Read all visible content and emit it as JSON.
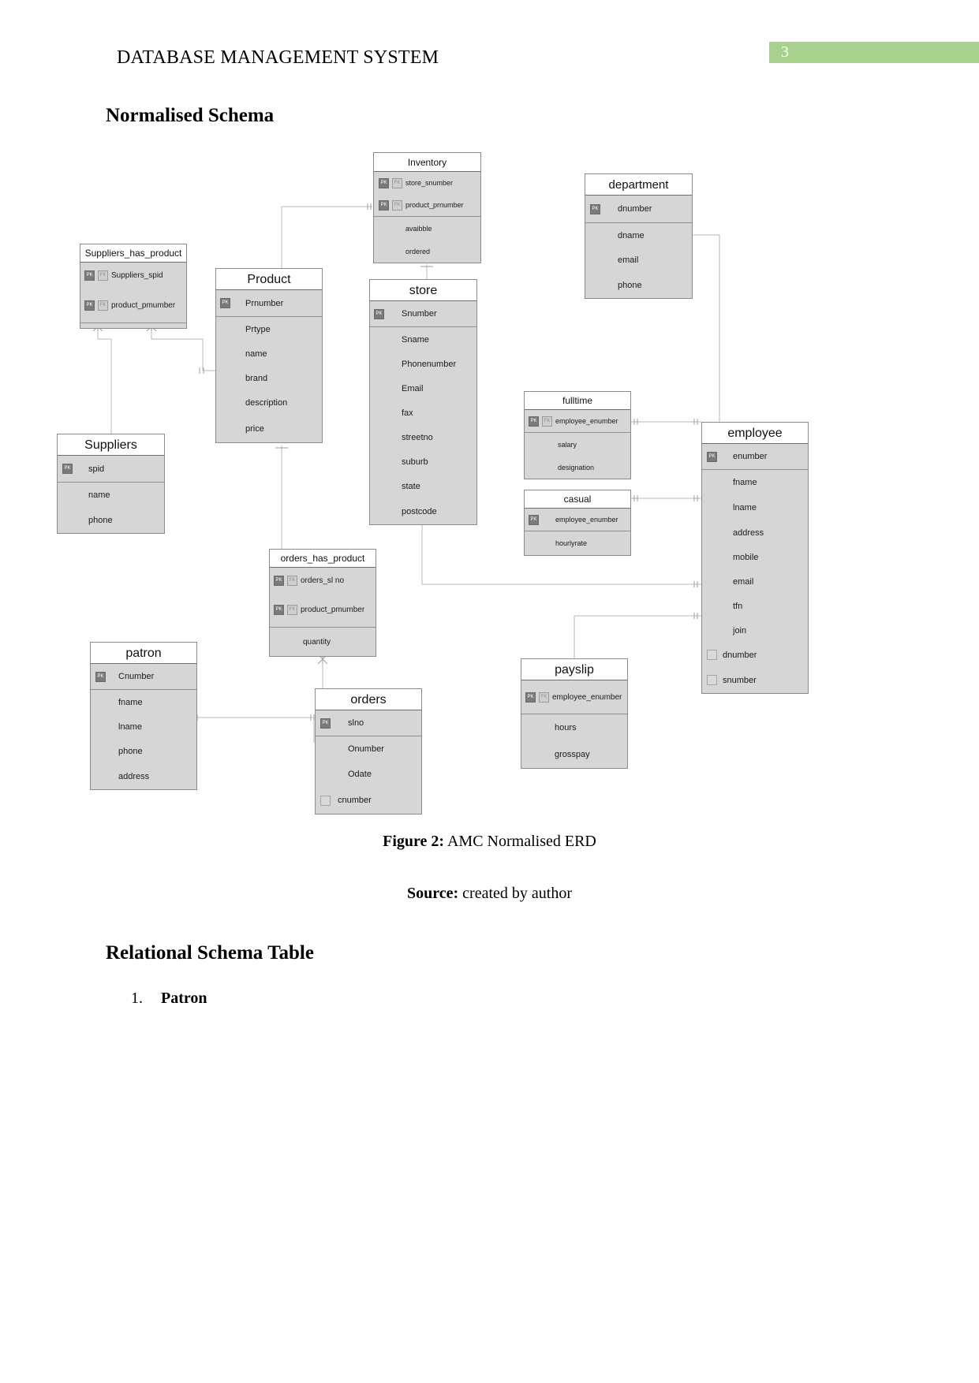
{
  "header": {
    "doc_title": "DATABASE MANAGEMENT SYSTEM",
    "page_number": "3",
    "badge_color": "#a9d18e"
  },
  "headings": {
    "normalised_schema": "Normalised Schema",
    "relational_schema": "Relational Schema Table"
  },
  "captions": {
    "figure_label": "Figure 2:",
    "figure_text": " AMC Normalised ERD",
    "source_label": "Source:",
    "source_text": " created by author"
  },
  "list": {
    "item1_number": "1.",
    "item1_label": "Patron"
  },
  "erd": {
    "entities": [
      {
        "id": "inventory",
        "title": "Inventory",
        "fields": [
          {
            "label": "store_snumber",
            "pk": true,
            "fk": true
          },
          {
            "label": "product_prnumber",
            "pk": true,
            "fk": true
          },
          {
            "label": "avaibble",
            "pk": false,
            "fk": false
          },
          {
            "label": "ordered",
            "pk": false,
            "fk": false
          }
        ]
      },
      {
        "id": "department",
        "title": "department",
        "fields": [
          {
            "label": "dnumber",
            "pk": true,
            "fk": false
          },
          {
            "label": "dname",
            "pk": false,
            "fk": false
          },
          {
            "label": "email",
            "pk": false,
            "fk": false
          },
          {
            "label": "phone",
            "pk": false,
            "fk": false
          }
        ]
      },
      {
        "id": "suppliers_has_product",
        "title": "Suppliers_has_product",
        "fields": [
          {
            "label": "Suppliers_spid",
            "pk": true,
            "fk": true
          },
          {
            "label": "product_pmumber",
            "pk": true,
            "fk": true
          }
        ]
      },
      {
        "id": "product",
        "title": "Product",
        "fields": [
          {
            "label": "Prnumber",
            "pk": true,
            "fk": false
          },
          {
            "label": "Prtype",
            "pk": false,
            "fk": false
          },
          {
            "label": "name",
            "pk": false,
            "fk": false
          },
          {
            "label": "brand",
            "pk": false,
            "fk": false
          },
          {
            "label": "description",
            "pk": false,
            "fk": false
          },
          {
            "label": "price",
            "pk": false,
            "fk": false
          }
        ]
      },
      {
        "id": "store",
        "title": "store",
        "fields": [
          {
            "label": "Snumber",
            "pk": true,
            "fk": false
          },
          {
            "label": "Sname",
            "pk": false,
            "fk": false
          },
          {
            "label": "Phonenumber",
            "pk": false,
            "fk": false
          },
          {
            "label": "Email",
            "pk": false,
            "fk": false
          },
          {
            "label": "fax",
            "pk": false,
            "fk": false
          },
          {
            "label": "streetno",
            "pk": false,
            "fk": false
          },
          {
            "label": "suburb",
            "pk": false,
            "fk": false
          },
          {
            "label": "state",
            "pk": false,
            "fk": false
          },
          {
            "label": "postcode",
            "pk": false,
            "fk": false
          }
        ]
      },
      {
        "id": "suppliers",
        "title": "Suppliers",
        "fields": [
          {
            "label": "spid",
            "pk": true,
            "fk": false
          },
          {
            "label": "name",
            "pk": false,
            "fk": false
          },
          {
            "label": "phone",
            "pk": false,
            "fk": false
          }
        ]
      },
      {
        "id": "fulltime",
        "title": "fulltime",
        "fields": [
          {
            "label": "employee_enumber",
            "pk": true,
            "fk": true
          },
          {
            "label": "salary",
            "pk": false,
            "fk": false
          },
          {
            "label": "designation",
            "pk": false,
            "fk": false
          }
        ]
      },
      {
        "id": "employee",
        "title": "employee",
        "fields": [
          {
            "label": "enumber",
            "pk": true,
            "fk": false
          },
          {
            "label": "fname",
            "pk": false,
            "fk": false
          },
          {
            "label": "lname",
            "pk": false,
            "fk": false
          },
          {
            "label": "address",
            "pk": false,
            "fk": false
          },
          {
            "label": "mobile",
            "pk": false,
            "fk": false
          },
          {
            "label": "email",
            "pk": false,
            "fk": false
          },
          {
            "label": "tfn",
            "pk": false,
            "fk": false
          },
          {
            "label": "join",
            "pk": false,
            "fk": false
          },
          {
            "label": "dnumber",
            "pk": false,
            "fk": true
          },
          {
            "label": "snumber",
            "pk": false,
            "fk": true
          }
        ]
      },
      {
        "id": "casual",
        "title": "casual",
        "fields": [
          {
            "label": "employee_enumber",
            "pk": true,
            "fk": false
          },
          {
            "label": "hourlyrate",
            "pk": false,
            "fk": false
          }
        ]
      },
      {
        "id": "orders_has_product",
        "title": "orders_has_product",
        "fields": [
          {
            "label": "orders_sl no",
            "pk": true,
            "fk": true
          },
          {
            "label": "product_pmumber",
            "pk": true,
            "fk": true
          },
          {
            "label": "quantity",
            "pk": false,
            "fk": false
          }
        ]
      },
      {
        "id": "patron",
        "title": "patron",
        "fields": [
          {
            "label": "Cnumber",
            "pk": true,
            "fk": false
          },
          {
            "label": "fname",
            "pk": false,
            "fk": false
          },
          {
            "label": "lname",
            "pk": false,
            "fk": false
          },
          {
            "label": "phone",
            "pk": false,
            "fk": false
          },
          {
            "label": "address",
            "pk": false,
            "fk": false
          }
        ]
      },
      {
        "id": "payslip",
        "title": "payslip",
        "fields": [
          {
            "label": "employee_enumber",
            "pk": true,
            "fk": true
          },
          {
            "label": "hours",
            "pk": false,
            "fk": false
          },
          {
            "label": "grosspay",
            "pk": false,
            "fk": false
          }
        ]
      },
      {
        "id": "orders",
        "title": "orders",
        "fields": [
          {
            "label": "slno",
            "pk": true,
            "fk": false
          },
          {
            "label": "Onumber",
            "pk": false,
            "fk": false
          },
          {
            "label": "Odate",
            "pk": false,
            "fk": false
          },
          {
            "label": "cnumber",
            "pk": false,
            "fk": true
          }
        ]
      }
    ],
    "key_badges": {
      "pk": "PK",
      "fk": "FK"
    }
  }
}
